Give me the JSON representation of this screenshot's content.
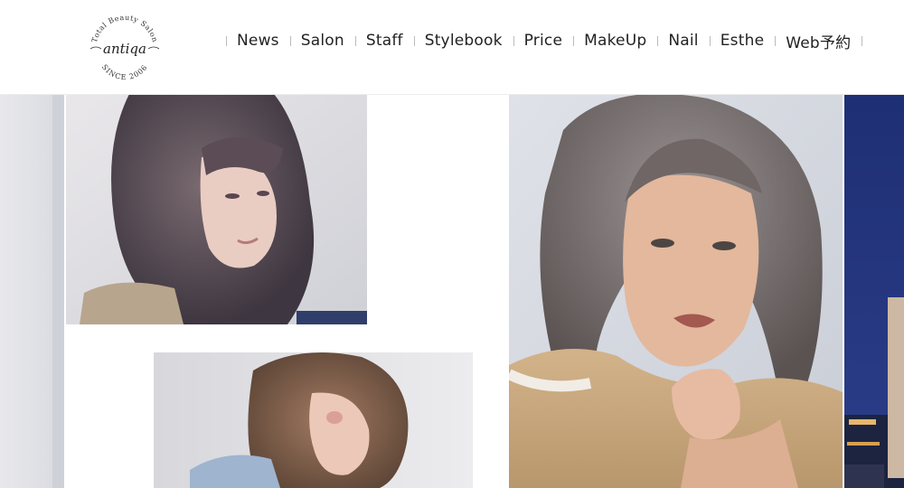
{
  "logo": {
    "top_text": "Total Beauty Salon",
    "name": "antiqa",
    "bottom_text": "SINCE 2006"
  },
  "nav": {
    "items": [
      "News",
      "Salon",
      "Staff",
      "Stylebook",
      "Price",
      "MakeUp",
      "Nail",
      "Esthe",
      "Web予約"
    ]
  },
  "gallery": {
    "images": [
      {
        "name": "left-edge-photo",
        "subject": "partial portrait edge"
      },
      {
        "name": "woman-bob-photo",
        "subject": "woman with ash bob looking over shoulder"
      },
      {
        "name": "woman-wavy-photo",
        "subject": "woman with wavy brown bob"
      },
      {
        "name": "woman-closeup-photo",
        "subject": "close-up portrait of woman with grey-brown wavy hair"
      },
      {
        "name": "salon-night-photo",
        "subject": "salon building at night"
      }
    ]
  },
  "colors": {
    "text": "#222222",
    "separator": "#bbbbbb",
    "header_border": "#ececec"
  }
}
